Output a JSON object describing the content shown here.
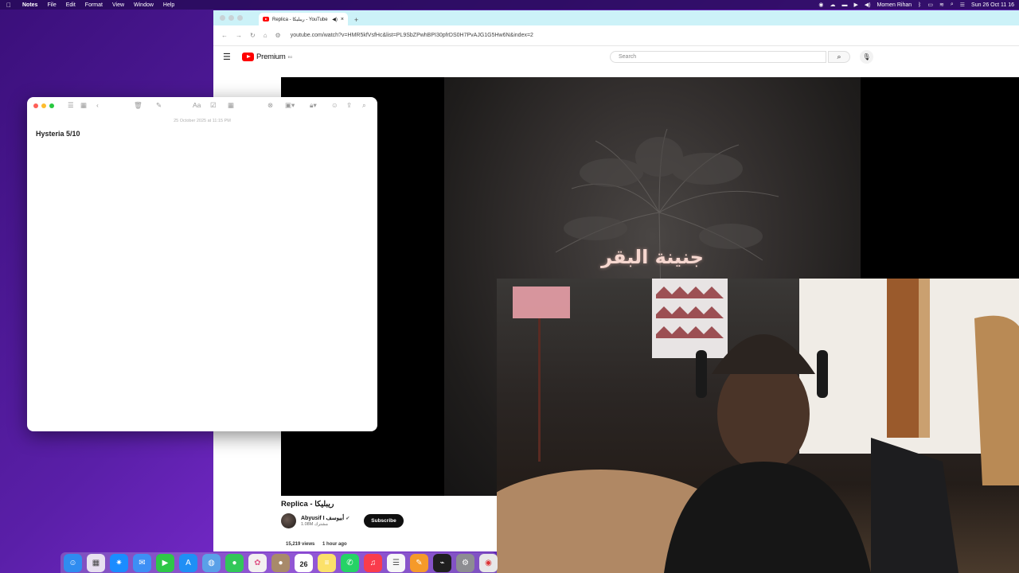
{
  "menubar": {
    "apple": "",
    "items": [
      "Notes",
      "File",
      "Edit",
      "Format",
      "View",
      "Window",
      "Help"
    ],
    "user": "Momen Rihan",
    "clock": "Sun 26 Oct 11 16"
  },
  "browser": {
    "tab_title": "Replica - ريبليكا - YouTube",
    "new_tab": "+",
    "url": "youtube.com/watch?v=HMR5kfVsfHc&list=PL9SbZPwhBPI30pfrDS0H7PvAJG1G5Hw6N&index=2"
  },
  "youtube": {
    "logo_text": "Premium",
    "logo_sup": "EG",
    "search_placeholder": "Search",
    "video_overlay_title": "جنينة البقر",
    "video_title": "Replica - ريبليكا",
    "channel_name": "Abyusif I أبيوسف",
    "subscribers": "1.08M مشترك",
    "subscribe_label": "Subscribe",
    "views": "15,219 views",
    "posted": "1 hour ago"
  },
  "notes": {
    "date": "25 October 2025 at 11:15 PM",
    "body": "Hysteria 5/10"
  },
  "dock": {
    "calendar_day": "26",
    "calendar_month": "OCT",
    "icon_colors": {
      "finder": "#2f8cf0",
      "launchpad": "#e8e0f0",
      "safari": "#1a8cff",
      "mail": "#3d8ff5",
      "facetime": "#2ec748",
      "appstore": "#1f8ff5",
      "photos": "#f3f0f0",
      "whatsapp": "#25d366",
      "music": "#fa3c4c"
    }
  },
  "colors": {
    "youtube_red": "#ff0000",
    "tab_bar": "#ccf2f8",
    "desktop": "#5a1fa8"
  }
}
